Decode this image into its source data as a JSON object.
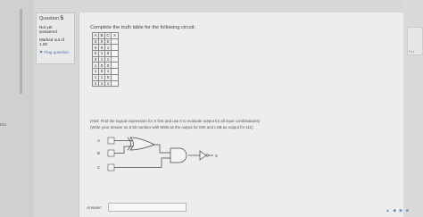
{
  "left_sidebar": {
    "partial_word": "ers"
  },
  "question": {
    "label": "Question",
    "number": "5",
    "status_line1": "Not yet",
    "status_line2": "answered",
    "marked_line1": "Marked out of",
    "marked_line2": "1.00",
    "flag_label": "Flag question"
  },
  "main": {
    "prompt": "Complete the truth table for the following circuit:",
    "truth_table": {
      "headers": [
        "A",
        "B",
        "C",
        "X"
      ],
      "rows": [
        [
          "0",
          "0",
          "0",
          ""
        ],
        [
          "0",
          "0",
          "1",
          ""
        ],
        [
          "0",
          "1",
          "0",
          ""
        ],
        [
          "0",
          "1",
          "1",
          ""
        ],
        [
          "1",
          "0",
          "0",
          ""
        ],
        [
          "1",
          "0",
          "1",
          ""
        ],
        [
          "1",
          "1",
          "0",
          ""
        ],
        [
          "1",
          "1",
          "1",
          ""
        ]
      ]
    },
    "hint": "(Hint: Find the logical expression for X first and use it to evaluate output for all input combinations)",
    "note": "(Write your answer as 8 bit number with MSB as the output for 000 and LSB as output for 111)",
    "circuit": {
      "inputs": [
        "A",
        "B",
        "C"
      ],
      "output": "X"
    },
    "answer_label": "Answer:",
    "answer_value": ""
  },
  "right_panel": {
    "partial_word": "Fini"
  },
  "bottom_icons": "▲ ◆ ▶ ■"
}
